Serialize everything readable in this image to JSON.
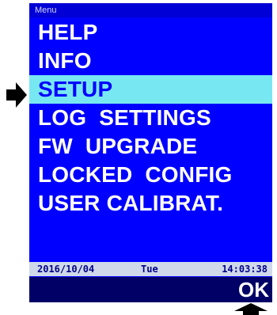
{
  "header": {
    "title": "Menu"
  },
  "menu": {
    "items": [
      {
        "label": "HELP"
      },
      {
        "label": "INFO"
      },
      {
        "label": "SETUP"
      },
      {
        "label": "LOG  SETTINGS"
      },
      {
        "label": "FW  UPGRADE"
      },
      {
        "label": "LOCKED  CONFIG"
      },
      {
        "label": "USER CALIBRAT."
      }
    ],
    "selected_index": 2
  },
  "status": {
    "date": "2016/10/04",
    "day": "Tue",
    "time": "14:03:38"
  },
  "softkeys": {
    "right_label": "OK"
  },
  "icons": {
    "selection_pointer": "right-arrow-icon",
    "ok_pointer": "up-arrow-icon"
  },
  "colors": {
    "screen_bg": "#0000ff",
    "selected_bg": "#77e8f2",
    "status_bg": "#cfd9ea",
    "softkey_bg": "#000066"
  }
}
